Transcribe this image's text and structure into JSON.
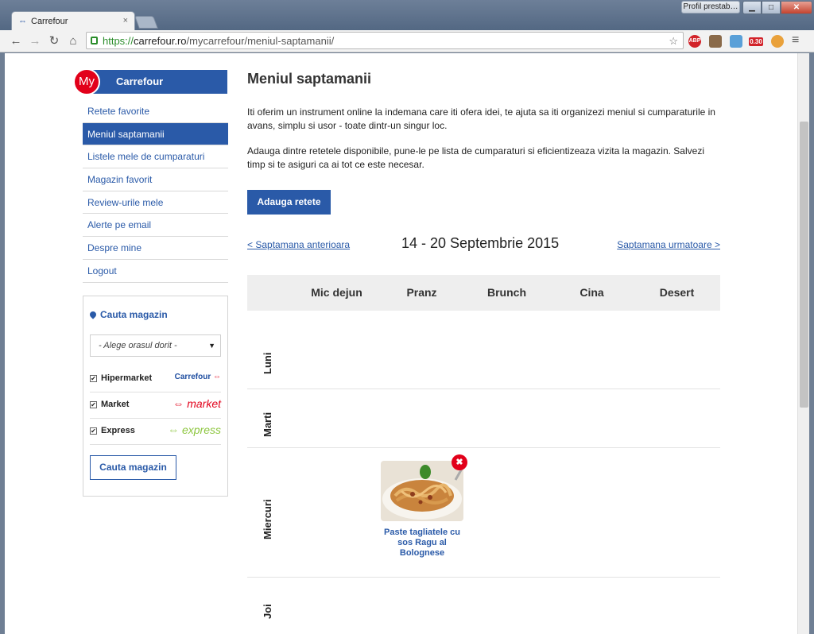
{
  "browser": {
    "tab_title": "Carrefour",
    "tab_close": "×",
    "profile_button": "Profil prestab…",
    "url_scheme": "https://",
    "url_host": "carrefour.ro",
    "url_path": "/mycarrefour/meniul-saptamanii/",
    "extensions": {
      "abp": "ABP",
      "timer": "0.30"
    }
  },
  "brand": {
    "badge": "My",
    "name": "Carrefour"
  },
  "sidenav": [
    {
      "label": "Retete favorite",
      "active": false
    },
    {
      "label": "Meniul saptamanii",
      "active": true
    },
    {
      "label": "Listele mele de cumparaturi",
      "active": false
    },
    {
      "label": "Magazin favorit",
      "active": false
    },
    {
      "label": "Review-urile mele",
      "active": false
    },
    {
      "label": "Alerte pe email",
      "active": false
    },
    {
      "label": "Despre mine",
      "active": false
    },
    {
      "label": "Logout",
      "active": false
    }
  ],
  "store_finder": {
    "title": "Cauta magazin",
    "city_select": "- Alege orasul dorit -",
    "types": [
      {
        "label": "Hipermarket",
        "checked": true,
        "logo": "Carrefour"
      },
      {
        "label": "Market",
        "checked": true,
        "logo": "market"
      },
      {
        "label": "Express",
        "checked": true,
        "logo": "express"
      }
    ],
    "button": "Cauta magazin"
  },
  "main": {
    "title": "Meniul saptamanii",
    "intro_1": "Iti oferim un instrument online la indemana care iti ofera idei, te ajuta sa iti organizezi meniul si cumparaturile in avans, simplu si usor - toate dintr-un singur loc.",
    "intro_2": "Adauga dintre retetele disponibile, pune-le pe lista de cumparaturi si eficientizeaza vizita la magazin. Salvezi timp si te asiguri ca ai tot ce este necesar.",
    "add_button": "Adauga retete",
    "week_prev": "< Saptamana anterioara",
    "week_label": "14 - 20 Septembrie 2015",
    "week_next": "Saptamana urmatoare >",
    "meals": [
      "Mic dejun",
      "Pranz",
      "Brunch",
      "Cina",
      "Desert"
    ],
    "days": [
      "Luni",
      "Marti",
      "Miercuri",
      "Joi"
    ],
    "recipe": {
      "day": "Miercuri",
      "meal": "Pranz",
      "name": "Paste tagliatele cu sos Ragu al Bolognese"
    }
  },
  "colors": {
    "brand_blue": "#2a5aa8",
    "brand_red": "#e2001a",
    "express_green": "#8dc63f"
  }
}
